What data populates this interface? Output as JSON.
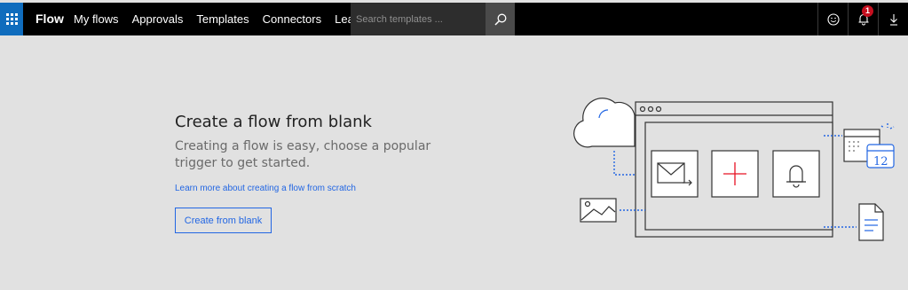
{
  "topbar": {
    "brand": "Flow",
    "nav": [
      {
        "label": "My flows"
      },
      {
        "label": "Approvals"
      },
      {
        "label": "Templates"
      },
      {
        "label": "Connectors"
      },
      {
        "label": "Learn"
      }
    ],
    "search_placeholder": "Search templates ...",
    "notification_count": "1",
    "icons": [
      "app-launcher-icon",
      "search-icon",
      "smiley-icon",
      "bell-icon",
      "download-icon"
    ],
    "accent_color": "#0f6cbd"
  },
  "hero": {
    "title": "Create a flow from blank",
    "description": "Creating a flow is easy, choose a popular trigger to get started.",
    "link": "Learn more about creating a flow from scratch",
    "button": "Create from blank",
    "link_color": "#2266e3"
  },
  "illustration": {
    "calendar_day": "12",
    "icons": [
      "cloud-icon",
      "image-icon",
      "mail-icon",
      "plus-icon",
      "bell-icon",
      "calendar-icon",
      "document-icon"
    ]
  }
}
